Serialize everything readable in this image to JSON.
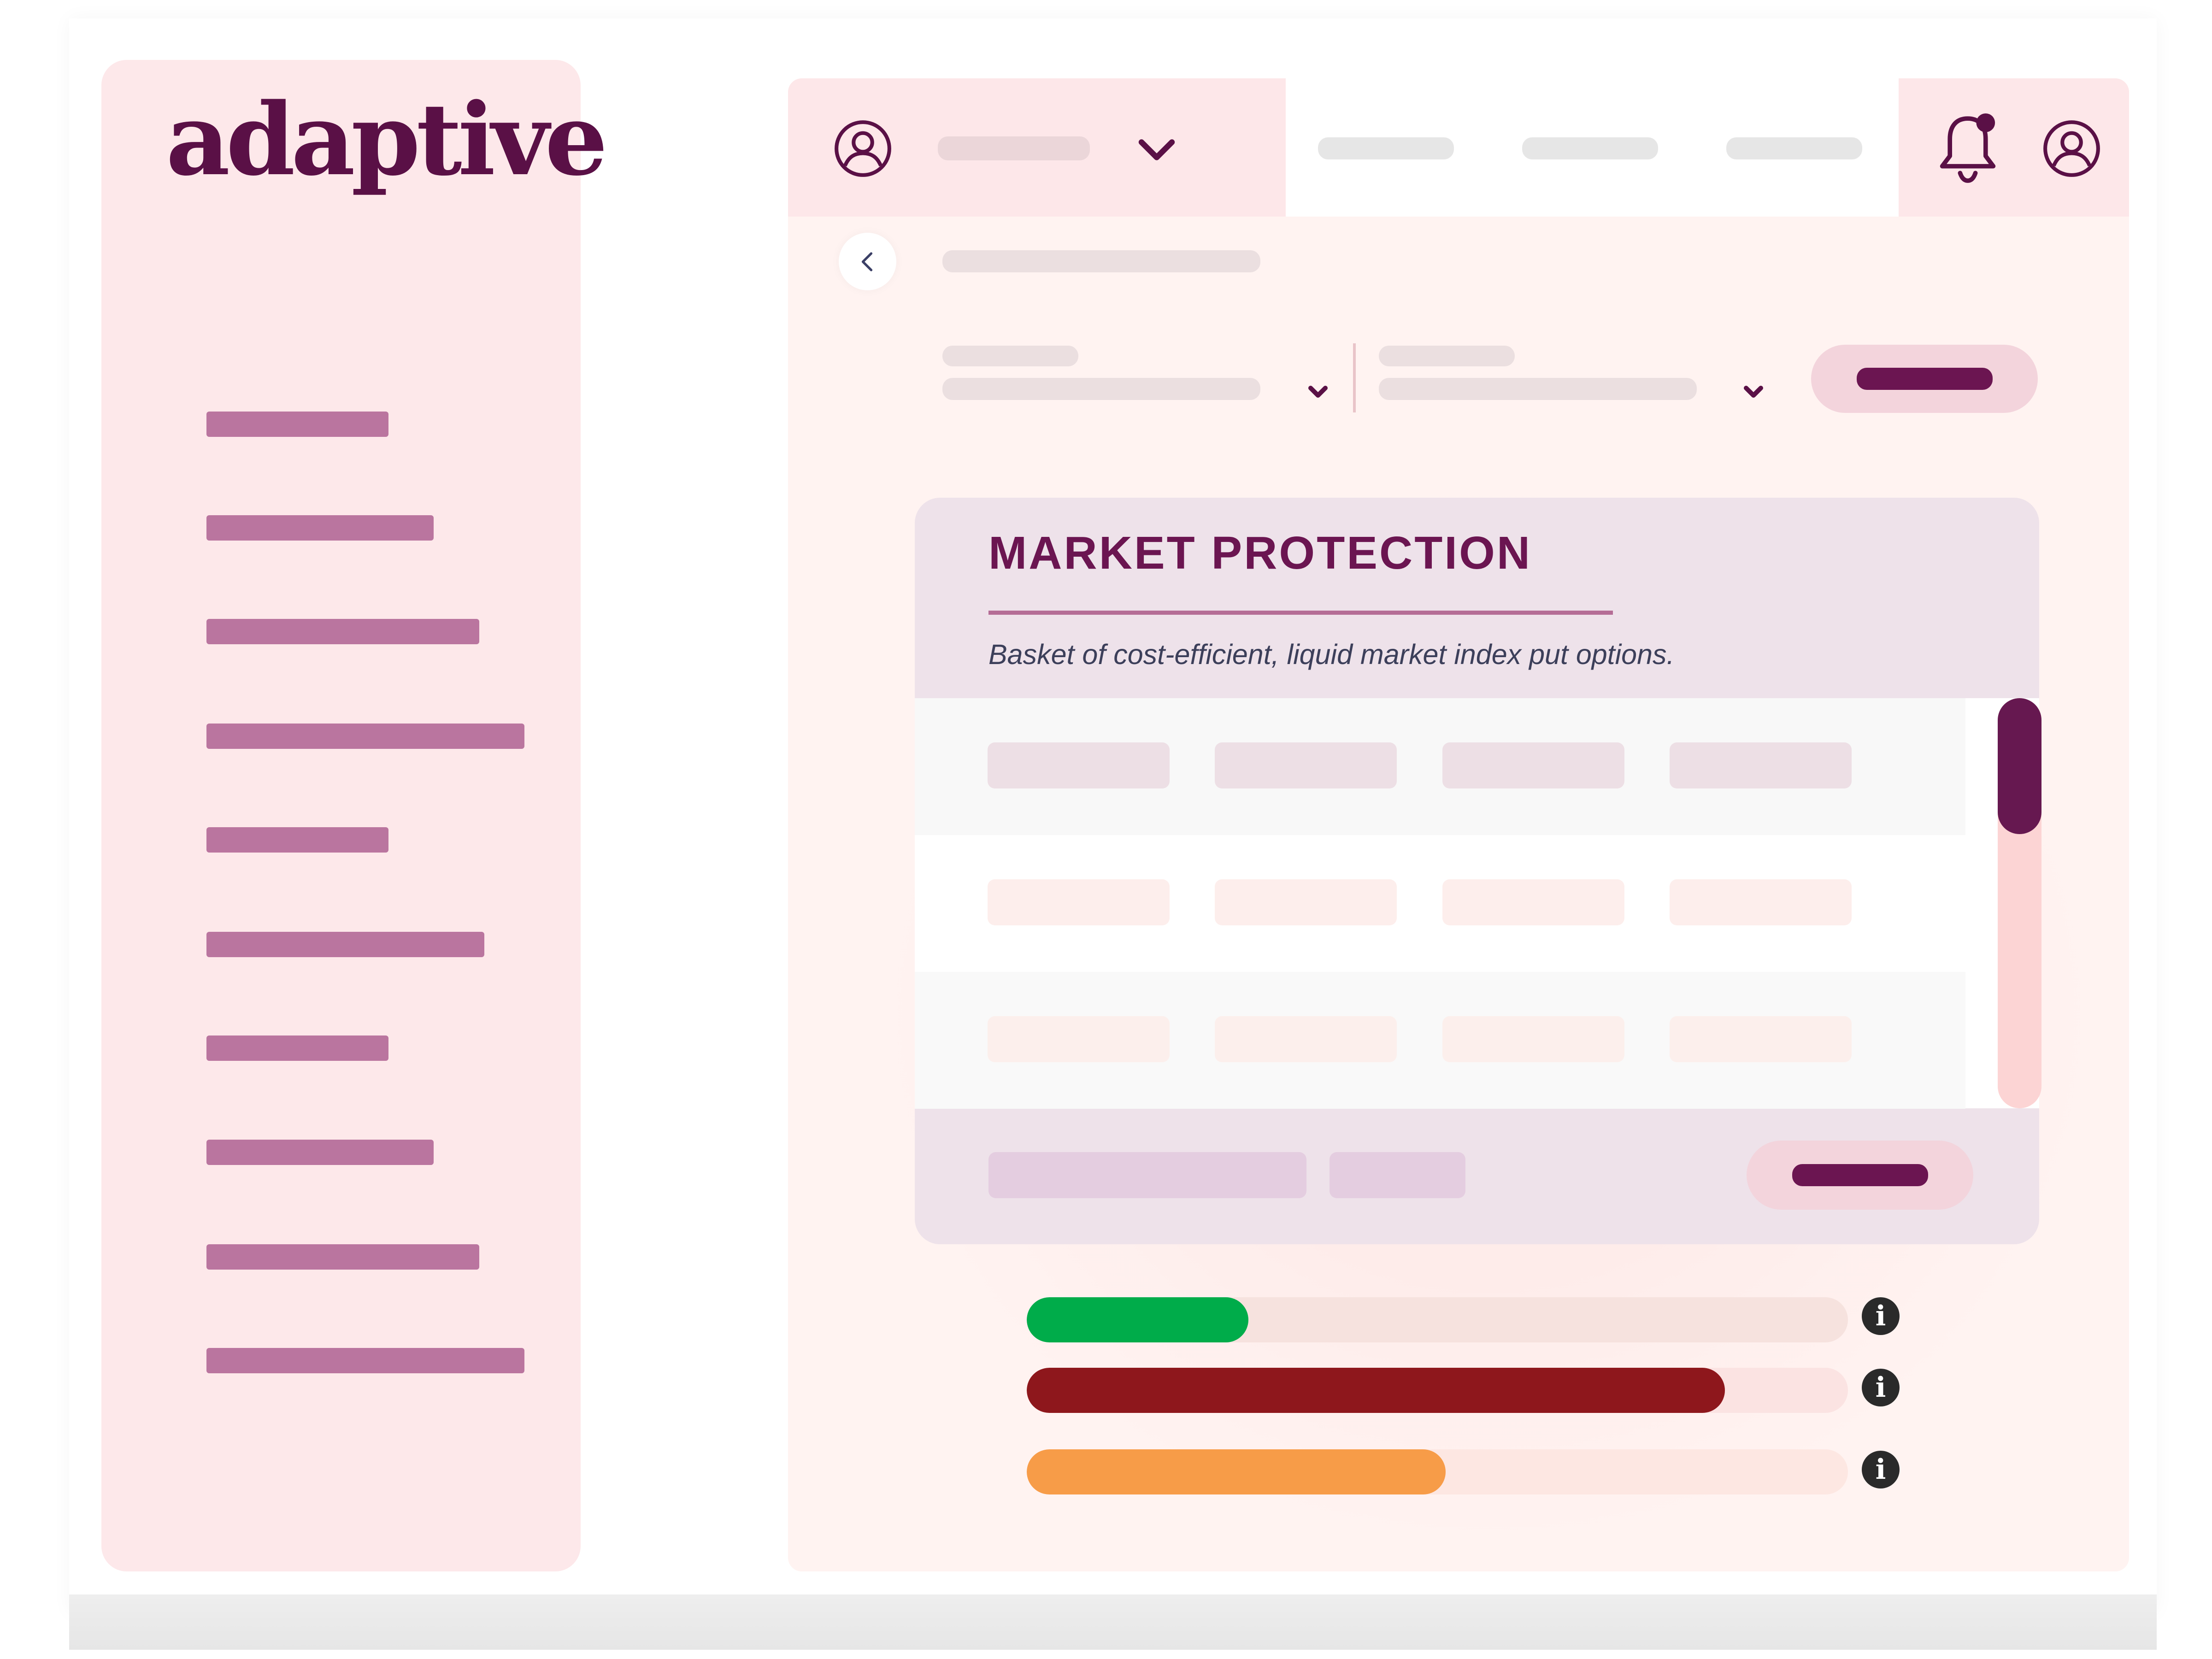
{
  "app": {
    "logo_text": "adaptive"
  },
  "sidebar": {
    "items": [
      {
        "label": ""
      },
      {
        "label": ""
      },
      {
        "label": ""
      },
      {
        "label": ""
      },
      {
        "label": ""
      },
      {
        "label": ""
      },
      {
        "label": ""
      },
      {
        "label": ""
      },
      {
        "label": ""
      },
      {
        "label": ""
      }
    ]
  },
  "header": {
    "account_dropdown": {
      "icon": "user-circle-icon",
      "chevron": "chevron-down-icon"
    },
    "notifications": {
      "icon": "bell-icon",
      "has_unread": true
    },
    "profile": {
      "icon": "user-circle-icon"
    }
  },
  "card": {
    "title": "MARKET PROTECTION",
    "subtitle": "Basket of cost-efficient, liquid market index put options."
  },
  "progress": [
    {
      "name": "green",
      "value": 0.27,
      "fill": "#00ac4a",
      "track": "#f6e2de"
    },
    {
      "name": "red",
      "value": 0.85,
      "fill": "#8e171c",
      "track": "#fbe3e2"
    },
    {
      "name": "orange",
      "value": 0.51,
      "fill": "#f79c48",
      "track": "#fde7e2"
    }
  ],
  "colors": {
    "brand": "#5a1046",
    "accent": "#6b1551",
    "sidebar_bg": "#fde8ea",
    "sidebar_item": "#ba759f"
  }
}
